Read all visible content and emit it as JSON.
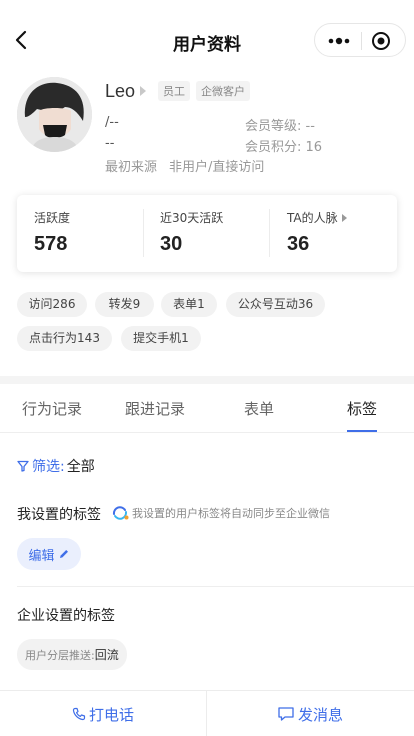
{
  "header": {
    "title": "用户资料"
  },
  "profile": {
    "name": "Leo",
    "tags": [
      "员工",
      "企微客户"
    ],
    "field_left_1": "/--",
    "field_left_2": "--",
    "member_level": "会员等级: --",
    "member_points": "会员积分: 16",
    "source_label": "最初来源",
    "source_value": "非用户/直接访问"
  },
  "stats": [
    {
      "label": "活跃度",
      "value": "578"
    },
    {
      "label": "近30天活跃",
      "value": "30"
    },
    {
      "label": "TA的人脉",
      "value": "36"
    }
  ],
  "chips": [
    "访问286",
    "转发9",
    "表单1",
    "公众号互动36",
    "点击行为143",
    "提交手机1"
  ],
  "tabs": {
    "items": [
      "行为记录",
      "跟进记录",
      "表单",
      "标签"
    ],
    "active": "标签"
  },
  "filter": {
    "label": "筛选:",
    "value": "全部"
  },
  "my_tags": {
    "title": "我设置的标签",
    "hint": "我设置的用户标签将自动同步至企业微信",
    "edit_label": "编辑"
  },
  "company_tags": {
    "title": "企业设置的标签",
    "segment_label": "用户分层推送:",
    "segment_value": "回流"
  },
  "bottom_bar": {
    "call_label": "打电话",
    "message_label": "发消息"
  },
  "colors": {
    "accent": "#3f6ee8",
    "chip_bg": "#f2f2f2"
  },
  "icons": [
    "back-arrow-icon",
    "more-dots-icon",
    "target-circle-icon",
    "filter-funnel-icon",
    "sync-icon",
    "pencil-icon",
    "phone-icon",
    "chat-bubble-icon"
  ]
}
